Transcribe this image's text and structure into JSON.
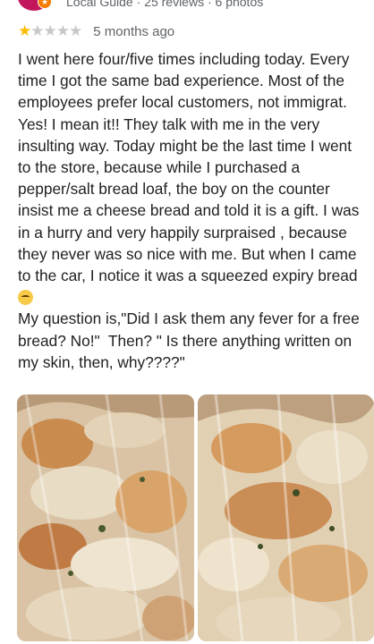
{
  "reviewer": {
    "meta": "Local Guide · 25 reviews · 6 photos",
    "badge_icon": "star-badge-icon",
    "avatar_color": "#c2185b"
  },
  "rating": {
    "stars": 1,
    "max": 5,
    "time_ago": "5 months ago",
    "star_color": "#fbbc04"
  },
  "review": {
    "text_main": "I went here four/five times including today. Every time I got the same bad experience. Most of the employees prefer local customers, not immigrat. Yes! I mean it!! They talk with me in the very insulting way. Today might be the last time I went to the store, because while I purchased a pepper/salt bread loaf, the boy on the counter insist me a cheese bread and told it is a gift. I was in a hurry and very happily surpraised , because they never was so nice with me. But when I came to the car, I notice it was a squeezed expiry bread",
    "emoji": "worried-face-emoji",
    "text_end": "My question is,\"Did I ask them any fever for a free bread? No!\"  Then? \" Is there anything written on my skin, then, why????\""
  },
  "photos": [
    {
      "name": "bread-photo-1",
      "subject": "squeezed cheese bread in plastic bag"
    },
    {
      "name": "bread-photo-2",
      "subject": "cheese bread in plastic bag close-up"
    }
  ]
}
